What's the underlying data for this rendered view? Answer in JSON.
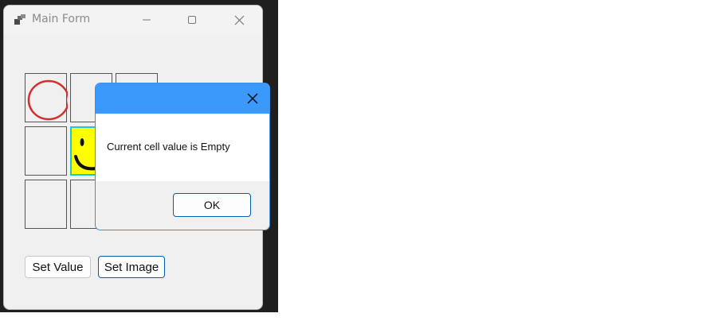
{
  "window": {
    "title": "Main Form",
    "icon": "app-window-icon",
    "controls": {
      "minimize": "minimize-icon",
      "maximize": "maximize-icon",
      "close": "close-icon"
    }
  },
  "grid": {
    "rows": 3,
    "cols": 3,
    "cells": [
      {
        "row": 0,
        "col": 0,
        "content": "circle"
      },
      {
        "row": 0,
        "col": 1,
        "content": "empty"
      },
      {
        "row": 0,
        "col": 2,
        "content": "empty"
      },
      {
        "row": 1,
        "col": 0,
        "content": "empty"
      },
      {
        "row": 1,
        "col": 1,
        "content": "smiley",
        "selected": true
      },
      {
        "row": 1,
        "col": 2,
        "content": "empty"
      },
      {
        "row": 2,
        "col": 0,
        "content": "empty"
      },
      {
        "row": 2,
        "col": 1,
        "content": "empty"
      },
      {
        "row": 2,
        "col": 2,
        "content": "empty"
      }
    ],
    "colors": {
      "circle": "#d32f2f",
      "smiley_bg": "#ffff00",
      "selection": "#20c6d8"
    }
  },
  "buttons": {
    "set_value_label": "Set Value",
    "set_image_label": "Set Image"
  },
  "dialog": {
    "message": "Current cell value is Empty",
    "ok_label": "OK",
    "title_color": "#3b99fc"
  }
}
